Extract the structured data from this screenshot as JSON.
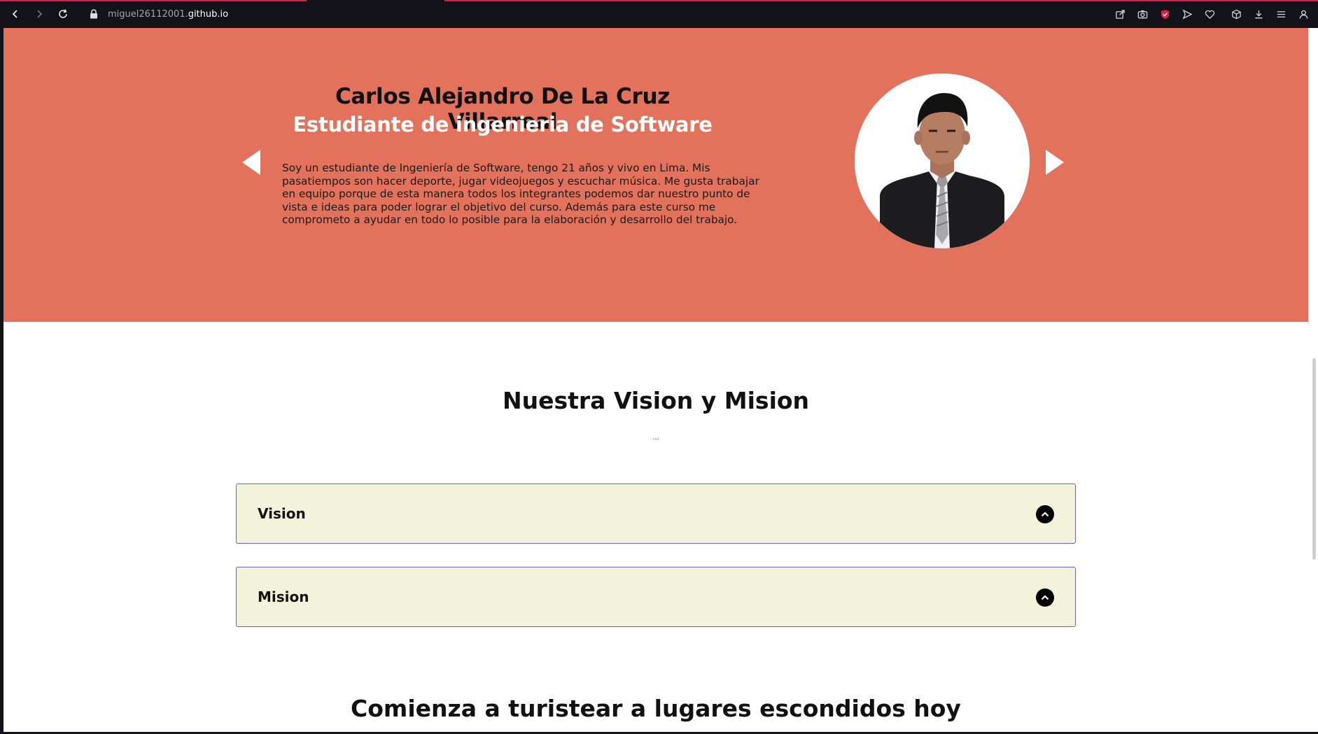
{
  "browser": {
    "url_host": "miguel26112001.",
    "url_domain": "github.io",
    "accent_color": "#c9264a"
  },
  "hero": {
    "background_color": "#e3725c",
    "name": "Carlos Alejandro De La Cruz Villarreal",
    "role": "Estudiante de ingenieria de Software",
    "description": "Soy un estudiante de Ingeniería de Software, tengo 21 años y vivo en Lima. Mis pasatiempos son hacer deporte, jugar videojuegos y escuchar música. Me gusta trabajar en equipo porque de esta manera todos los integrantes podemos dar nuestro punto de vista e ideas para poder lograr el objetivo del curso. Además para este curso me comprometo a ayudar en todo lo posible para la elaboración y desarrollo del trabajo.",
    "prev_icon": "triangle-left-icon",
    "next_icon": "triangle-right-icon"
  },
  "vision_mision": {
    "title": "Nuestra Vision y Mision",
    "subtitle": "...",
    "accordion_color": "#f3f2da",
    "items": [
      {
        "label": "Vision",
        "icon": "chevron-up-circle-icon"
      },
      {
        "label": "Mision",
        "icon": "chevron-up-circle-icon"
      }
    ]
  },
  "next_section": {
    "title": "Comienza a turistear a lugares escondidos hoy"
  }
}
